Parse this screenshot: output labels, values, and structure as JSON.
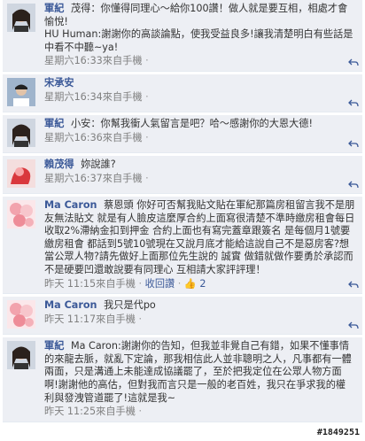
{
  "comments": [
    {
      "author": "軍紀",
      "text": "茂得：你懂得同理心～給你100讚！做人就是要互相，相處才會愉悅!\nHU Human:謝謝你的高談論點，使我受益良多!讓我清楚明白有些話是中看不中聽~ya!",
      "time": "星期六16:33來自手機",
      "avatar": "female"
    },
    {
      "author": "宋承安",
      "text": "",
      "time": "星期六16:34來自手機",
      "avatar": "male"
    },
    {
      "author": "軍紀",
      "text": "小安：你幫我衝人氣留言是吧？哈～感謝你的大恩大德!",
      "time": "星期六16:36來自手機",
      "avatar": "female"
    },
    {
      "author": "賴茂得",
      "text": "妳說誰?",
      "time": "星期六16:37來自手機",
      "avatar": "red"
    },
    {
      "author": "Ma Caron",
      "text": "蔡恩頭 你好可否幫我貼文貼在軍紀那篇房租留言我不是朋友無法貼文 就是有人臉皮這麼厚合約上面寫很清楚不準時繳房租會每日收取2%滯納金扣到押金 合約上面也有寫完蓋章跟簽名 是每個月1號要繳房租會 都話到5號10號現在又說月底才能給這說自己不是惡房客?想當公眾人物?請先做好上面那位先生說的 誠實 做錯就做作要勇於承認而不是硬要凹還敢說要有同理心 互相請大家評評理！",
      "time": "昨天 11:15來自手機",
      "recall": "收回讚",
      "likes": "2",
      "avatar": "pink"
    },
    {
      "author": "Ma Caron",
      "text": "我只是代po",
      "time": "昨天 11:17來自手機",
      "avatar": "pink"
    },
    {
      "author": "軍紀",
      "text": "Ma Caron:謝謝你的告知，但我並非覺自己有錯，如果不懂事情的來龍去脈，就亂下定論，那我相信此人並非聰明之人，凡事都有一體兩面，只是溝通上未能達成協議罷了，至於把我定位在公眾人物方面啊!謝謝他的高估，但對我而言只是一般的老百姓，我只在爭求我的權利與發洩管道罷了!這就是我~",
      "time": "昨天 11:25來自手機",
      "avatar": "female"
    }
  ],
  "ui": {
    "like_icon": "thumbs-up-icon",
    "reply_icon": "reply-icon",
    "watermark": "#1849251"
  },
  "colors": {
    "link": "#3b5998",
    "comment_bg": "#edeff4",
    "meta": "#808080"
  }
}
